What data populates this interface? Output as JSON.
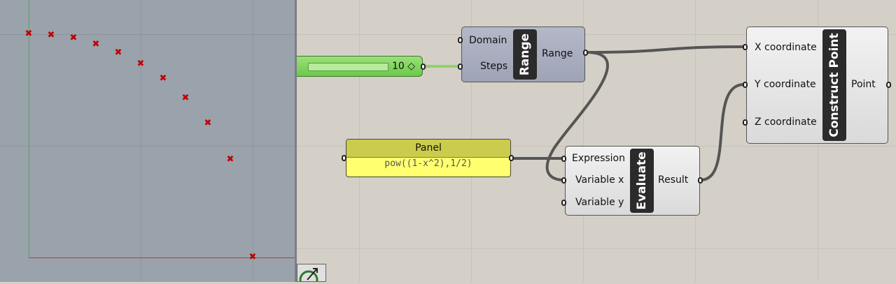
{
  "viewport": {
    "points": [
      {
        "x": 0.0,
        "y": 1.0
      },
      {
        "x": 0.1,
        "y": 0.995
      },
      {
        "x": 0.2,
        "y": 0.98
      },
      {
        "x": 0.3,
        "y": 0.954
      },
      {
        "x": 0.4,
        "y": 0.917
      },
      {
        "x": 0.5,
        "y": 0.866
      },
      {
        "x": 0.6,
        "y": 0.8
      },
      {
        "x": 0.7,
        "y": 0.714
      },
      {
        "x": 0.8,
        "y": 0.6
      },
      {
        "x": 0.9,
        "y": 0.436
      },
      {
        "x": 1.0,
        "y": 0.0
      }
    ],
    "axis_colors": {
      "x": "#c0392b",
      "y": "#4caf50"
    },
    "point_color": "#c00000"
  },
  "slider": {
    "value": "10",
    "diamond": "◇"
  },
  "range": {
    "name": "Range",
    "inputs": [
      "Domain",
      "Steps"
    ],
    "outputs": [
      "Range"
    ]
  },
  "panel": {
    "title": "Panel",
    "content": "pow((1-x^2),1/2)"
  },
  "evaluate": {
    "name": "Evaluate",
    "inputs": [
      "Expression",
      "Variable x",
      "Variable y"
    ],
    "outputs": [
      "Result"
    ]
  },
  "construct_point": {
    "name": "Construct Point",
    "inputs": [
      "X coordinate",
      "Y coordinate",
      "Z coordinate"
    ],
    "outputs": [
      "Point"
    ]
  },
  "colors": {
    "canvas": "#d4d0c8",
    "slider": "#6cc94a",
    "panel": "#ffff70",
    "wire": "#555555",
    "slider_wire": "#8fd16a"
  }
}
